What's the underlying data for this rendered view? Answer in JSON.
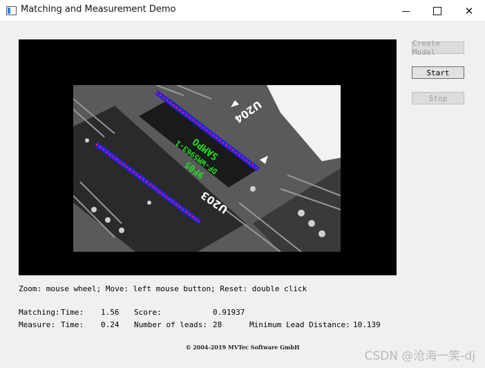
{
  "window": {
    "title": "Matching and Measurement Demo"
  },
  "buttons": {
    "create_model": "Create Model",
    "start": "Start",
    "stop": "Stop"
  },
  "help_text": "Zoom: mouse wheel; Move: left mouse button; Reset: double click",
  "results": {
    "matching_label": "Matching:",
    "time_label": "Time:",
    "matching_time": "1.56",
    "score_label": "Score:",
    "score": "0.91937",
    "measure_label": "Measure:",
    "measure_time": "0.24",
    "leads_label": "Number of leads:",
    "leads": "28",
    "min_dist_label": "Minimum Lead Distance:",
    "min_dist": "10.139"
  },
  "image_labels": {
    "chip_text_1": "SAMPO",
    "chip_text_2": "DF-WM5963-1",
    "chip_text_3": "9F05",
    "pcb_label_1": "U204",
    "pcb_label_2": "U203"
  },
  "copyright": "© 2004-2019 MVTec Software GmbH",
  "watermark": "CSDN @沧海一笑-dj",
  "colors": {
    "match_green": "#22dd22",
    "lead_red": "#ff2020",
    "lead_blue": "#2020ff"
  }
}
